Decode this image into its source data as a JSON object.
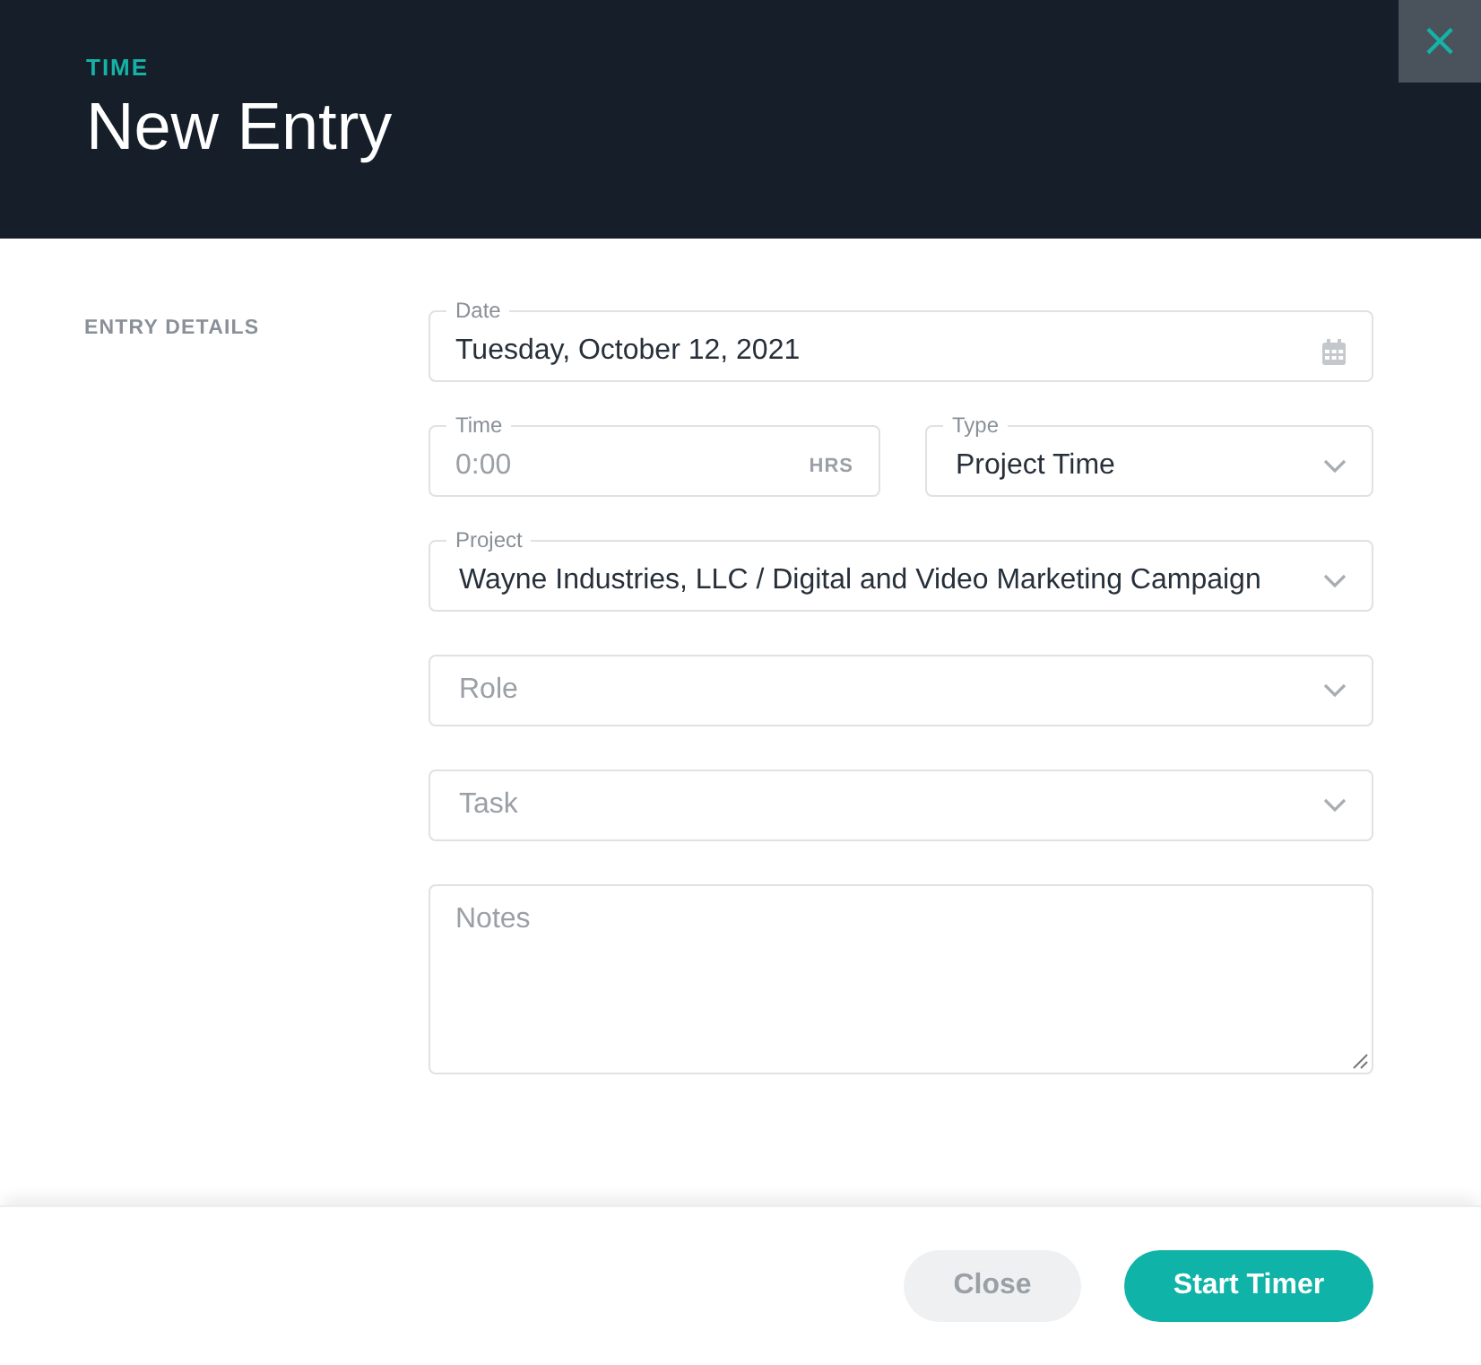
{
  "header": {
    "eyebrow": "TIME",
    "title": "New Entry",
    "close_icon": "×"
  },
  "section": {
    "label": "ENTRY DETAILS"
  },
  "rows": [
    [
      {
        "kind": "date",
        "label": "Date",
        "value": "Tuesday, October 12, 2021"
      }
    ],
    [
      {
        "kind": "time",
        "label": "Time",
        "placeholder": "0:00",
        "suffix": "HRS"
      },
      {
        "kind": "select",
        "label": "Type",
        "value": "Project Time"
      }
    ],
    [
      {
        "kind": "select",
        "label": "Project",
        "value": "Wayne Industries, LLC / Digital and Video Marketing Campaign"
      }
    ],
    [
      {
        "kind": "select",
        "placeholder": "Role"
      }
    ],
    [
      {
        "kind": "select",
        "placeholder": "Task"
      }
    ],
    [
      {
        "kind": "textarea",
        "placeholder": "Notes"
      }
    ]
  ],
  "buttons": [
    {
      "kind": "secondary",
      "label": "Close"
    },
    {
      "kind": "primary",
      "label": "Start Timer"
    }
  ]
}
